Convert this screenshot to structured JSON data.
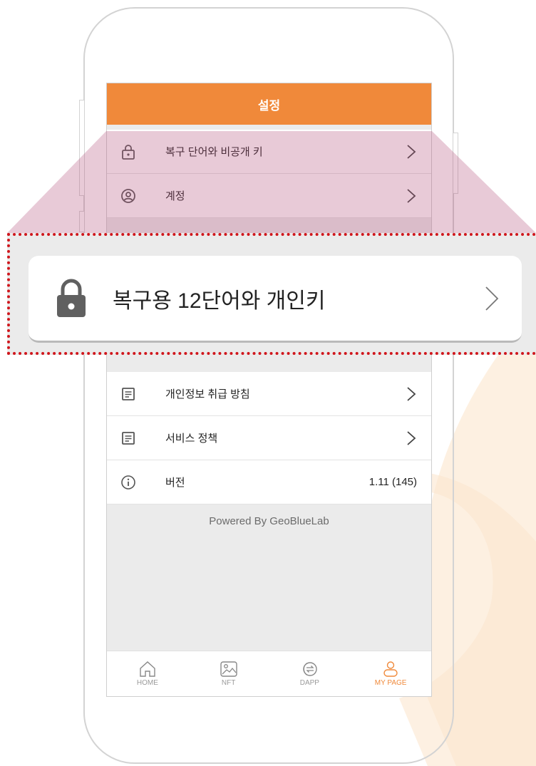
{
  "app": {
    "title": "설정"
  },
  "settings_top": [
    {
      "label": "복구 단어와 비공개 키",
      "icon": "lock-icon"
    },
    {
      "label": "계정",
      "icon": "account-circle-icon"
    }
  ],
  "callout": {
    "label": "복구용 12단어와 개인키",
    "icon": "lock-icon"
  },
  "settings_bottom": [
    {
      "label": "개인정보 취급 방침",
      "icon": "document-icon"
    },
    {
      "label": "서비스 정책",
      "icon": "document-icon"
    },
    {
      "label": "버전",
      "icon": "info-icon",
      "value": "1.11 (145)"
    }
  ],
  "footer": {
    "powered_by": "Powered By GeoBlueLab"
  },
  "tabs": [
    {
      "label": "HOME",
      "icon": "home-icon",
      "active": false
    },
    {
      "label": "NFT",
      "icon": "image-icon",
      "active": false
    },
    {
      "label": "DAPP",
      "icon": "dapp-icon",
      "active": false
    },
    {
      "label": "MY PAGE",
      "icon": "user-icon",
      "active": true
    }
  ],
  "colors": {
    "accent": "#f0893a",
    "highlight_border": "#d0161c",
    "magnifier": "#c88fa8",
    "swoosh": "#fdecd8"
  }
}
